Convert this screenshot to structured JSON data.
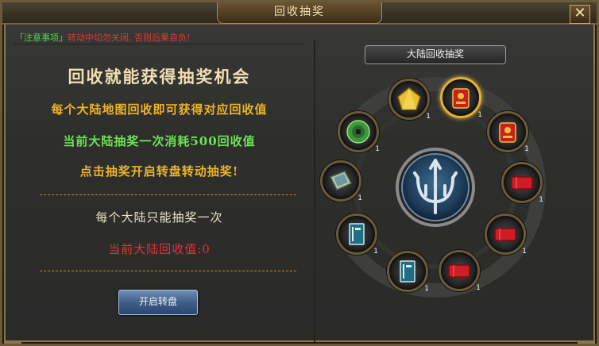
{
  "window": {
    "title": "回收抽奖",
    "close_glyph": "✕"
  },
  "notice": {
    "tag": "「注意事项」",
    "message": "转动中切勿关闭, 否则后果自负!"
  },
  "info": {
    "headline": "回收就能获得抽奖机会",
    "line1": "每个大陆地图回收即可获得对应回收值",
    "line2": "当前大陆抽奖一次消耗500回收值",
    "line3": "点击抽奖开启转盘转动抽奖!",
    "line4": "每个大陆只能抽奖一次",
    "current_label": "当前大陆回收值:",
    "current_value": "0"
  },
  "start_button": "开启转盘",
  "wheel": {
    "label": "大陆回收抽奖",
    "selected_index": 1,
    "items": [
      {
        "icon": "gold-ore-icon",
        "count": "1"
      },
      {
        "icon": "red-armor-icon",
        "count": "1"
      },
      {
        "icon": "red-armor-icon",
        "count": "1"
      },
      {
        "icon": "red-scroll-icon",
        "count": "1"
      },
      {
        "icon": "red-scroll-icon",
        "count": "1"
      },
      {
        "icon": "red-scroll-icon",
        "count": "1"
      },
      {
        "icon": "blue-book-icon",
        "count": "1"
      },
      {
        "icon": "blue-book-icon",
        "count": "1"
      },
      {
        "icon": "skill-book-icon",
        "count": "1"
      },
      {
        "icon": "jade-coin-icon",
        "count": "1"
      }
    ]
  },
  "colors": {
    "accent_gold": "#ecb428",
    "green": "#6ee256",
    "red": "#e63232",
    "frame": "#8c7650"
  }
}
